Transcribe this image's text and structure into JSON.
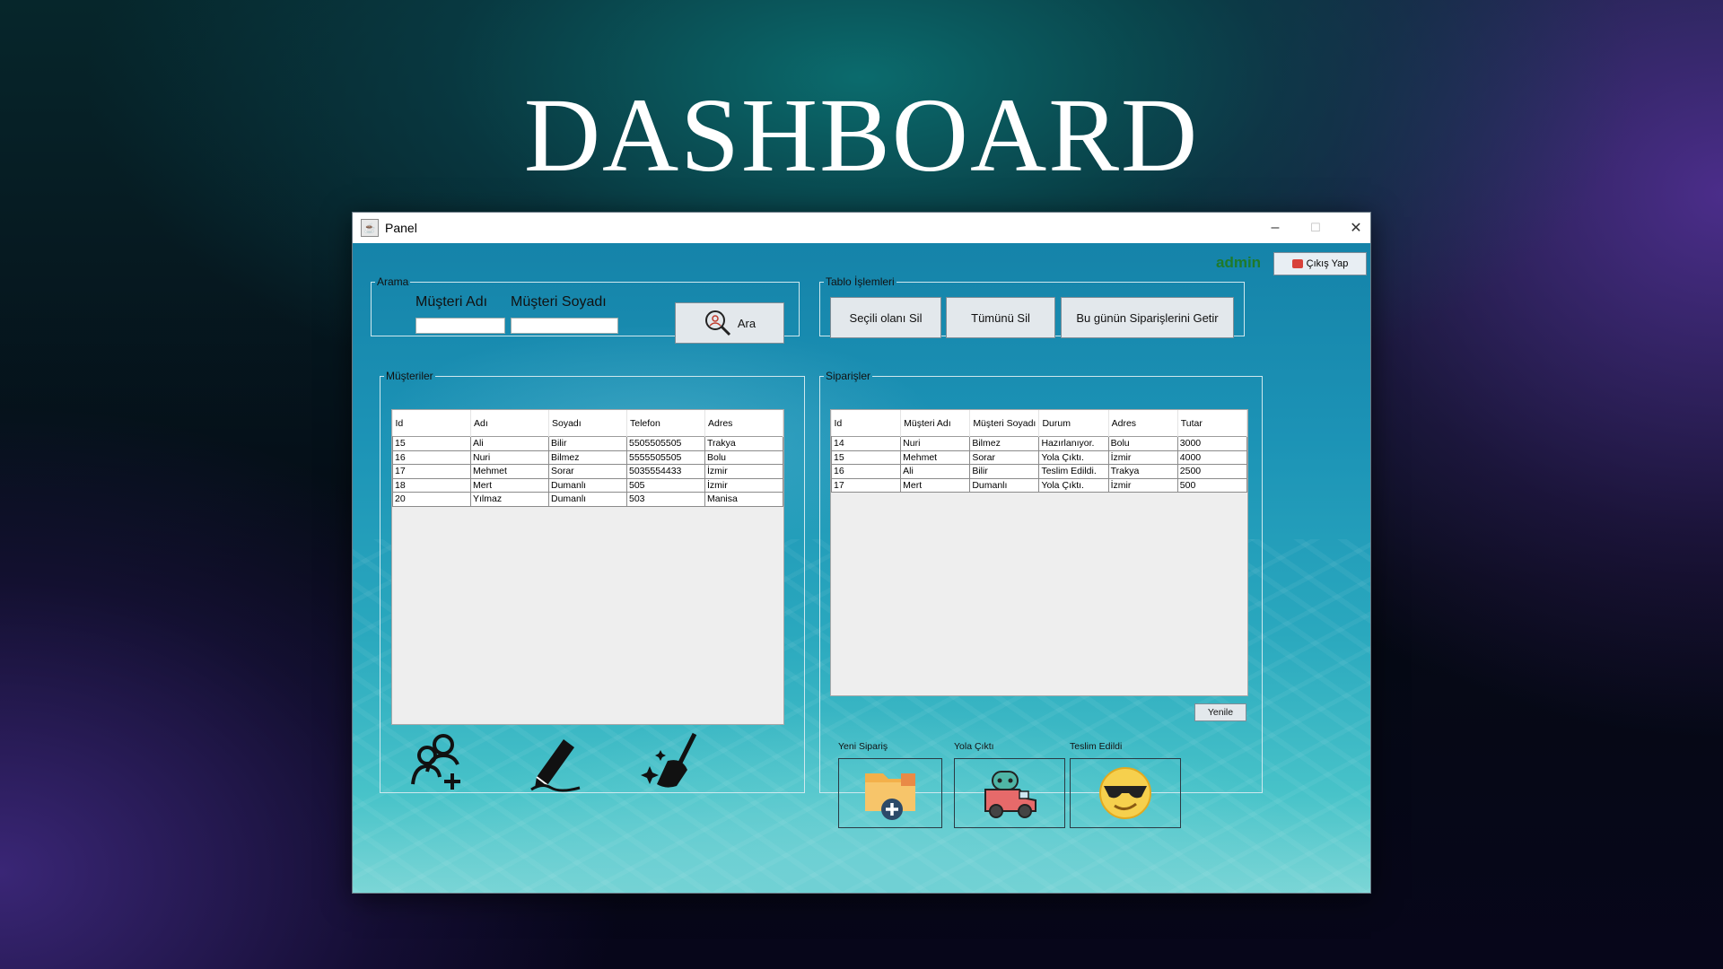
{
  "page_title": "DASHBOARD",
  "window": {
    "title": "Panel",
    "minimize": "–",
    "maximize": "☐",
    "close": "✕"
  },
  "user": {
    "name": "admin",
    "logout_label": "Çıkış Yap"
  },
  "search": {
    "legend": "Arama",
    "first_name_label": "Müşteri Adı",
    "last_name_label": "Müşteri Soyadı",
    "first_name_value": "",
    "last_name_value": "",
    "button_label": "Ara"
  },
  "table_ops": {
    "legend": "Tablo İşlemleri",
    "delete_selected": "Seçili olanı Sil",
    "delete_all": "Tümünü Sil",
    "fetch_today": "Bu günün Siparişlerini Getir"
  },
  "customers": {
    "legend": "Müşteriler",
    "columns": [
      "Id",
      "Adı",
      "Soyadı",
      "Telefon",
      "Adres"
    ],
    "rows": [
      [
        "15",
        "Ali",
        "Bilir",
        "5505505505",
        "Trakya"
      ],
      [
        "16",
        "Nuri",
        "Bilmez",
        "5555505505",
        "Bolu"
      ],
      [
        "17",
        "Mehmet",
        "Sorar",
        "5035554433",
        "İzmir"
      ],
      [
        "18",
        "Mert",
        "Dumanlı",
        "505",
        "İzmir"
      ],
      [
        "20",
        "Yılmaz",
        "Dumanlı",
        "503",
        "Manisa"
      ]
    ],
    "actions": {
      "add_icon": "add-user-icon",
      "edit_icon": "pencil-icon",
      "clean_icon": "broom-icon"
    }
  },
  "orders": {
    "legend": "Siparişler",
    "columns": [
      "Id",
      "Müşteri Adı",
      "Müşteri Soyadı",
      "Durum",
      "Adres",
      "Tutar"
    ],
    "rows": [
      [
        "14",
        "Nuri",
        "Bilmez",
        "Hazırlanıyor.",
        "Bolu",
        "3000"
      ],
      [
        "15",
        "Mehmet",
        "Sorar",
        "Yola Çıktı.",
        "İzmir",
        "4000"
      ],
      [
        "16",
        "Ali",
        "Bilir",
        "Teslim Edildi.",
        "Trakya",
        "2500"
      ],
      [
        "17",
        "Mert",
        "Dumanlı",
        "Yola Çıktı.",
        "İzmir",
        "500"
      ]
    ],
    "refresh_label": "Yenile",
    "new_order_label": "Yeni Sipariş",
    "on_the_way_label": "Yola Çıktı",
    "delivered_label": "Teslim Edildi"
  },
  "colors": {
    "accent_green": "#1f7a2a",
    "window_bg": "#1c93b6"
  }
}
